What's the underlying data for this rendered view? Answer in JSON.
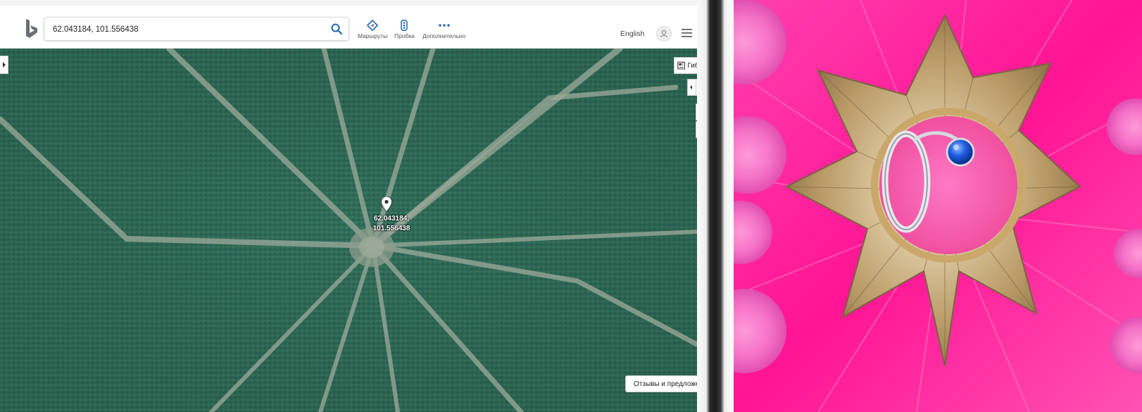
{
  "search": {
    "value": "62.043184, 101.556438"
  },
  "nav": {
    "routes": {
      "label": "Маршруты",
      "icon": "route-diamond-icon"
    },
    "traffic": {
      "label": "Пробки",
      "icon": "traffic-light-icon"
    },
    "more": {
      "label": "Дополнительно",
      "icon": "more-dots-icon"
    }
  },
  "header": {
    "language": "English"
  },
  "map": {
    "layer_button": "Гибри...",
    "pin_label_line1": "62.043184,",
    "pin_label_line2": "101.556438",
    "zoom_in": "+",
    "zoom_out": "−",
    "feedback": "Отзывы и предложения"
  },
  "colors": {
    "accent_blue": "#1e66b0",
    "forest": "#2d6a57",
    "clearing": "#9aa89a",
    "pink": "#ff1493",
    "gold": "#b89a66",
    "sapphire": "#1f5ee0"
  }
}
